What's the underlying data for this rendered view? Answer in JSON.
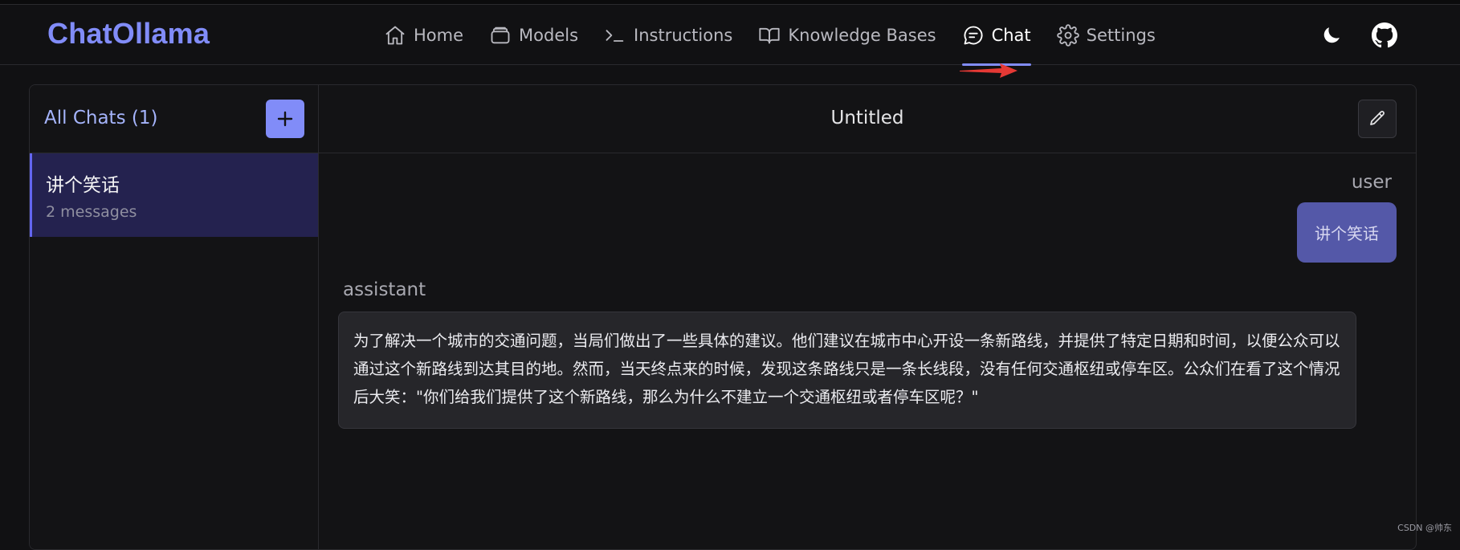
{
  "app": {
    "brand": "ChatOllama"
  },
  "nav": {
    "items": [
      {
        "label": "Home",
        "icon": "home-icon"
      },
      {
        "label": "Models",
        "icon": "models-icon"
      },
      {
        "label": "Instructions",
        "icon": "terminal-icon"
      },
      {
        "label": "Knowledge Bases",
        "icon": "book-icon"
      },
      {
        "label": "Chat",
        "icon": "chat-icon",
        "active": true
      },
      {
        "label": "Settings",
        "icon": "gear-icon"
      }
    ]
  },
  "header_right": {
    "theme_icon": "moon-icon",
    "github_icon": "github-icon"
  },
  "sidebar": {
    "title": "All Chats (1)",
    "new_button_icon": "plus-icon",
    "chats": [
      {
        "title": "讲个笑话",
        "subtitle": "2 messages"
      }
    ]
  },
  "chat": {
    "title": "Untitled",
    "edit_icon": "pencil-icon",
    "messages": [
      {
        "role": "user",
        "content": "讲个笑话"
      },
      {
        "role": "assistant",
        "content": "为了解决一个城市的交通问题，当局们做出了一些具体的建议。他们建议在城市中心开设一条新路线，并提供了特定日期和时间，以便公众可以通过这个新路线到达其目的地。然而，当天终点来的时候，发现这条路线只是一条长线段，没有任何交通枢纽或停车区。公众们在看了这个情况后大笑：\"你们给我们提供了这个新路线，那么为什么不建立一个交通枢纽或者停车区呢？\""
      }
    ]
  },
  "watermark": "CSDN @帅东",
  "colors": {
    "accent": "#818cf8",
    "background": "#111113",
    "user_bubble": "#5458a8",
    "selected_chat": "#24224f",
    "annotation_arrow": "#e53935"
  }
}
